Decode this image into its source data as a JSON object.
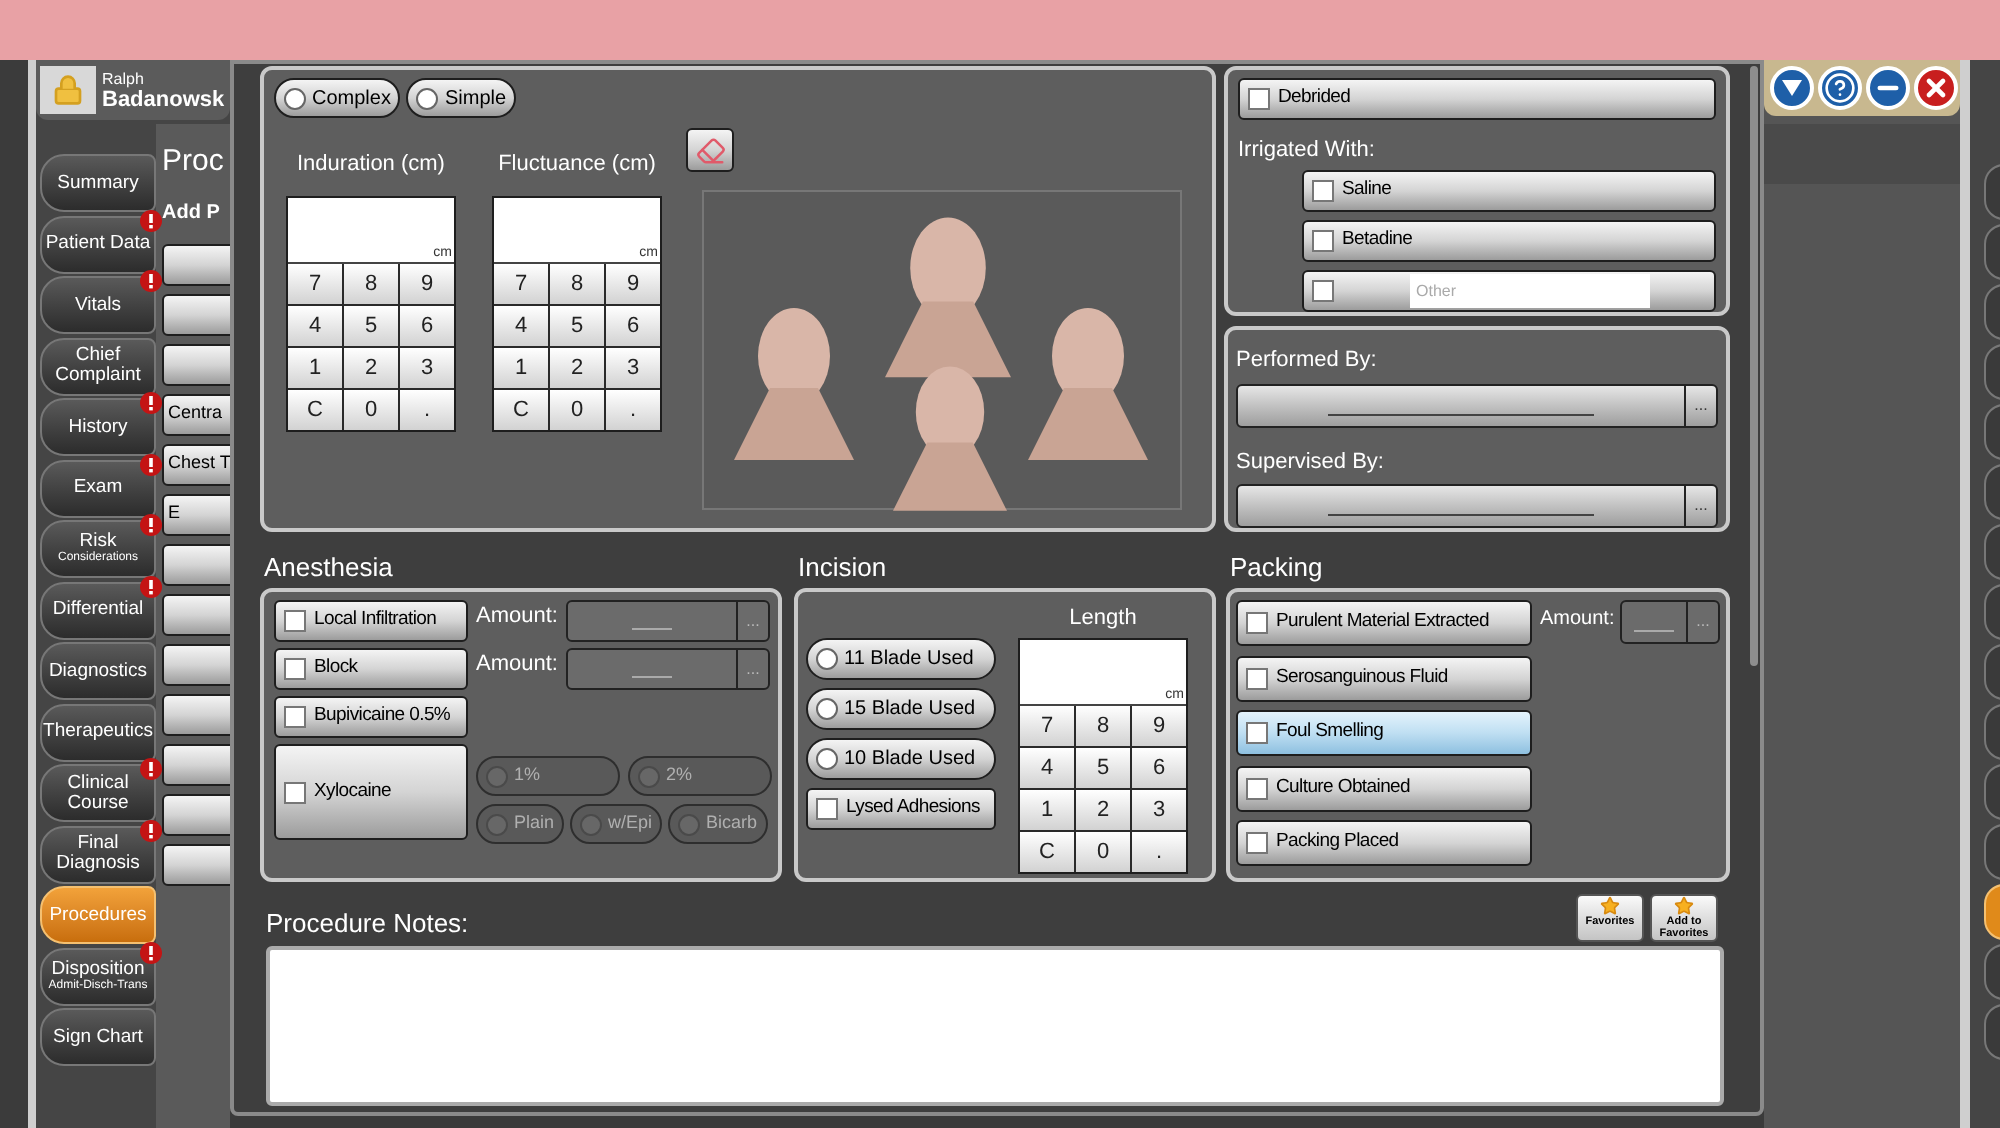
{
  "user": {
    "first_name": "Ralph",
    "last_name": "Badanowsk"
  },
  "nav_tabs": [
    {
      "label": "Summary",
      "alert": false,
      "selected": false
    },
    {
      "label": "Patient Data",
      "alert": true,
      "selected": false
    },
    {
      "label": "Vitals",
      "alert": true,
      "selected": false
    },
    {
      "label": "Chief Complaint",
      "alert": false,
      "selected": false
    },
    {
      "label": "History",
      "alert": true,
      "selected": false
    },
    {
      "label": "Exam",
      "alert": true,
      "selected": false
    },
    {
      "label": "Risk",
      "sublabel": "Considerations",
      "alert": true,
      "selected": false
    },
    {
      "label": "Differential",
      "alert": true,
      "selected": false
    },
    {
      "label": "Diagnostics",
      "alert": false,
      "selected": false
    },
    {
      "label": "Therapeutics",
      "alert": false,
      "selected": false
    },
    {
      "label": "Clinical Course",
      "alert": true,
      "selected": false
    },
    {
      "label": "Final Diagnosis",
      "alert": true,
      "selected": false
    },
    {
      "label": "Procedures",
      "alert": false,
      "selected": true
    },
    {
      "label": "Disposition",
      "sublabel": "Admit-Disch-Trans",
      "alert": true,
      "selected": false
    },
    {
      "label": "Sign Chart",
      "alert": false,
      "selected": false
    }
  ],
  "background_page": {
    "title": "Proc",
    "subtitle": "Add P",
    "buttons": [
      {
        "kind": "blank"
      },
      {
        "kind": "blank"
      },
      {
        "kind": "blank"
      },
      {
        "kind": "text",
        "label": "Centra"
      },
      {
        "kind": "text",
        "label": "Chest T"
      },
      {
        "kind": "text",
        "label": "E"
      },
      {
        "kind": "blank"
      },
      {
        "kind": "blank"
      },
      {
        "kind": "blank"
      },
      {
        "kind": "blank"
      },
      {
        "kind": "blank"
      },
      {
        "kind": "blank"
      },
      {
        "kind": "blank"
      }
    ]
  },
  "complexity": [
    {
      "label": "Complex",
      "selected": false
    },
    {
      "label": "Simple",
      "selected": false
    }
  ],
  "keypads": [
    {
      "title": "Induration (cm)",
      "unit": "cm",
      "keys": [
        "7",
        "8",
        "9",
        "4",
        "5",
        "6",
        "1",
        "2",
        "3",
        "C",
        "0",
        "."
      ]
    },
    {
      "title": "Fluctuance (cm)",
      "unit": "cm",
      "keys": [
        "7",
        "8",
        "9",
        "4",
        "5",
        "6",
        "1",
        "2",
        "3",
        "C",
        "0",
        "."
      ]
    }
  ],
  "debrided": {
    "label": "Debrided",
    "checked": false
  },
  "irrigated": {
    "label": "Irrigated With:",
    "options": [
      {
        "kind": "checkbox",
        "label": "Saline",
        "checked": false
      },
      {
        "kind": "checkbox",
        "label": "Betadine",
        "checked": false
      },
      {
        "kind": "other",
        "placeholder": "Other",
        "checked": false
      }
    ]
  },
  "staff": [
    {
      "label": "Performed By:",
      "button": "..."
    },
    {
      "label": "Supervised By:",
      "button": "..."
    }
  ],
  "anesthesia": {
    "title": "Anesthesia",
    "options": [
      {
        "label": "Local Infiltration",
        "checked": false,
        "amount": {
          "label": "Amount:",
          "button": "..."
        }
      },
      {
        "label": "Block",
        "checked": false,
        "amount": {
          "label": "Amount:",
          "button": "..."
        }
      },
      {
        "label": "Bupivicaine 0.5%",
        "checked": false
      }
    ],
    "xylocaine": {
      "label": "Xylocaine",
      "checked": false,
      "strengths": [
        {
          "label": "1%",
          "selected": false,
          "disabled": true
        },
        {
          "label": "2%",
          "selected": false,
          "disabled": true
        }
      ],
      "types": [
        {
          "label": "Plain",
          "selected": false,
          "disabled": true
        },
        {
          "label": "w/Epi",
          "selected": false,
          "disabled": true
        },
        {
          "label": "Bicarb",
          "selected": false,
          "disabled": true
        }
      ]
    }
  },
  "incision": {
    "title": "Incision",
    "blades": [
      {
        "label": "11 Blade Used",
        "selected": false
      },
      {
        "label": "15 Blade Used",
        "selected": false
      },
      {
        "label": "10 Blade Used",
        "selected": false
      }
    ],
    "lysed": {
      "label": "Lysed Adhesions",
      "checked": false
    },
    "keypad": {
      "title": "Length",
      "unit": "cm",
      "keys": [
        "7",
        "8",
        "9",
        "4",
        "5",
        "6",
        "1",
        "2",
        "3",
        "C",
        "0",
        "."
      ]
    }
  },
  "packing": {
    "title": "Packing",
    "options": [
      {
        "label": "Purulent Material Extracted",
        "checked": false,
        "highlighted": false
      },
      {
        "label": "Serosanguinous Fluid",
        "checked": false,
        "highlighted": false
      },
      {
        "label": "Foul Smelling",
        "checked": false,
        "highlighted": true
      },
      {
        "label": "Culture Obtained",
        "checked": false,
        "highlighted": false
      },
      {
        "label": "Packing Placed",
        "checked": false,
        "highlighted": false
      }
    ],
    "amount": {
      "label": "Amount:",
      "button": "..."
    }
  },
  "notes": {
    "title": "Procedure Notes:",
    "favorites": [
      {
        "label": "Favorites"
      },
      {
        "label": "Add to Favorites"
      }
    ]
  }
}
